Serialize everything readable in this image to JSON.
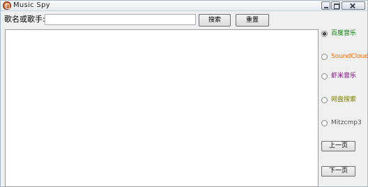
{
  "window": {
    "title": "Music  Spy"
  },
  "search": {
    "label": "歌名或歌手:",
    "value": "",
    "placeholder": ""
  },
  "buttons": {
    "search": "搜索",
    "reset": "重置",
    "prev": "上一页",
    "next": "下一页"
  },
  "sources": [
    {
      "label": "百度音乐",
      "color": "#008000",
      "checked": true
    },
    {
      "label": "SoundCloud",
      "color": "#ff6600",
      "checked": false
    },
    {
      "label": "虾米音乐",
      "color": "#800080",
      "checked": false
    },
    {
      "label": "网盘搜索",
      "color": "#808000",
      "checked": false
    },
    {
      "label": "Mitzcmp3",
      "color": "#555555",
      "checked": false
    }
  ]
}
